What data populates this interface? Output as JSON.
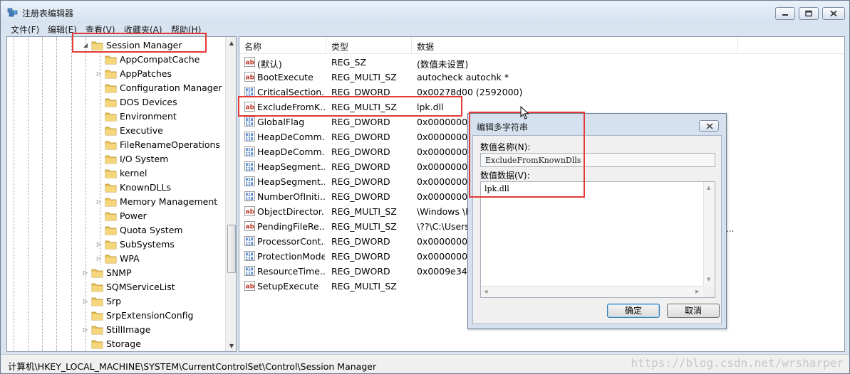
{
  "window": {
    "title": "注册表编辑器",
    "buttons": {
      "minimize": "minimize-icon",
      "maximize": "maximize-icon",
      "close": "close-icon"
    }
  },
  "menu": [
    "文件(F)",
    "编辑(E)",
    "查看(V)",
    "收藏夹(A)",
    "帮助(H)"
  ],
  "tree": {
    "selected": "Session Manager",
    "children": [
      {
        "label": "AppCompatCache",
        "expandable": false
      },
      {
        "label": "AppPatches",
        "expandable": true
      },
      {
        "label": "Configuration Manager",
        "expandable": false
      },
      {
        "label": "DOS Devices",
        "expandable": false
      },
      {
        "label": "Environment",
        "expandable": false
      },
      {
        "label": "Executive",
        "expandable": false
      },
      {
        "label": "FileRenameOperations",
        "expandable": false
      },
      {
        "label": "I/O System",
        "expandable": false
      },
      {
        "label": "kernel",
        "expandable": false
      },
      {
        "label": "KnownDLLs",
        "expandable": false
      },
      {
        "label": "Memory Management",
        "expandable": true
      },
      {
        "label": "Power",
        "expandable": false
      },
      {
        "label": "Quota System",
        "expandable": false
      },
      {
        "label": "SubSystems",
        "expandable": true
      },
      {
        "label": "WPA",
        "expandable": true
      }
    ],
    "siblings": [
      {
        "label": "SNMP",
        "expandable": true
      },
      {
        "label": "SQMServiceList",
        "expandable": false
      },
      {
        "label": "Srp",
        "expandable": true
      },
      {
        "label": "SrpExtensionConfig",
        "expandable": false
      },
      {
        "label": "StillImage",
        "expandable": true
      },
      {
        "label": "Storage",
        "expandable": false
      }
    ]
  },
  "list": {
    "columns": [
      "名称",
      "类型",
      "数据"
    ],
    "rows": [
      {
        "name": "(默认)",
        "type": "REG_SZ",
        "data": "(数值未设置)",
        "icon": "string-value-icon"
      },
      {
        "name": "BootExecute",
        "type": "REG_MULTI_SZ",
        "data": "autocheck autochk *",
        "icon": "string-value-icon"
      },
      {
        "name": "CriticalSection...",
        "type": "REG_DWORD",
        "data": "0x00278d00 (2592000)",
        "icon": "binary-value-icon"
      },
      {
        "name": "ExcludeFromK...",
        "type": "REG_MULTI_SZ",
        "data": "lpk.dll",
        "icon": "string-value-icon"
      },
      {
        "name": "GlobalFlag",
        "type": "REG_DWORD",
        "data": "0x00000000",
        "icon": "binary-value-icon"
      },
      {
        "name": "HeapDeComm...",
        "type": "REG_DWORD",
        "data": "0x00000000",
        "icon": "binary-value-icon"
      },
      {
        "name": "HeapDeComm...",
        "type": "REG_DWORD",
        "data": "0x00000000",
        "icon": "binary-value-icon"
      },
      {
        "name": "HeapSegment...",
        "type": "REG_DWORD",
        "data": "0x00000000",
        "icon": "binary-value-icon"
      },
      {
        "name": "HeapSegment...",
        "type": "REG_DWORD",
        "data": "0x00000000",
        "icon": "binary-value-icon"
      },
      {
        "name": "NumberOfIniti...",
        "type": "REG_DWORD",
        "data": "0x00000002",
        "icon": "binary-value-icon"
      },
      {
        "name": "ObjectDirector...",
        "type": "REG_MULTI_SZ",
        "data": "\\Windows \\R",
        "icon": "string-value-icon"
      },
      {
        "name": "PendingFileRe...",
        "type": "REG_MULTI_SZ",
        "data": "\\??\\C:\\Users\\",
        "icon": "string-value-icon"
      },
      {
        "name": "ProcessorCont...",
        "type": "REG_DWORD",
        "data": "0x00000002",
        "icon": "binary-value-icon"
      },
      {
        "name": "ProtectionMode",
        "type": "REG_DWORD",
        "data": "0x00000001",
        "icon": "binary-value-icon"
      },
      {
        "name": "ResourceTime...",
        "type": "REG_DWORD",
        "data": "0x0009e340",
        "icon": "binary-value-icon"
      },
      {
        "name": "SetupExecute",
        "type": "REG_MULTI_SZ",
        "data": "",
        "icon": "string-value-icon"
      }
    ],
    "overflow_ellipsis": "..."
  },
  "dialog": {
    "title": "编辑多字符串",
    "name_label": "数值名称(N):",
    "name_value": "ExcludeFromKnownDlls",
    "data_label": "数值数据(V):",
    "data_value": "lpk.dll",
    "ok": "确定",
    "cancel": "取消"
  },
  "status": {
    "path": "计算机\\HKEY_LOCAL_MACHINE\\SYSTEM\\CurrentControlSet\\Control\\Session Manager",
    "watermark": "https://blog.csdn.net/wrsharper"
  },
  "colors": {
    "highlight": "#e53935",
    "folder": "#e8c35a"
  }
}
